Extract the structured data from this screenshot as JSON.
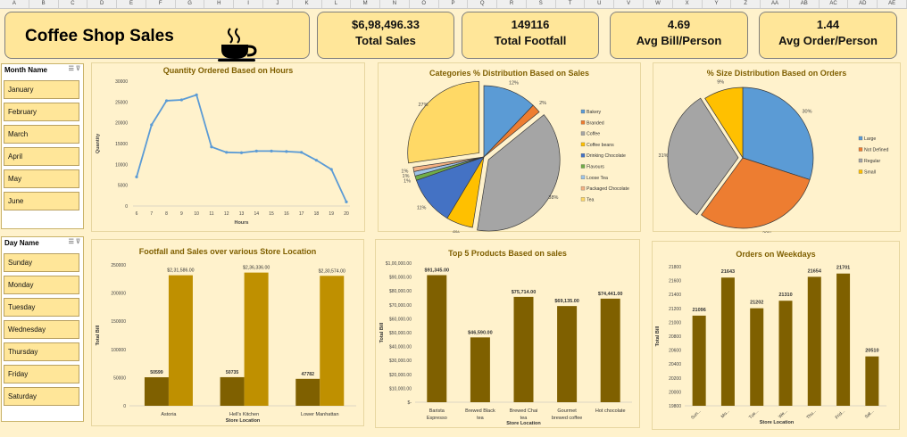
{
  "column_headers": [
    "A",
    "B",
    "C",
    "D",
    "E",
    "F",
    "G",
    "H",
    "I",
    "J",
    "K",
    "L",
    "M",
    "N",
    "O",
    "P",
    "Q",
    "R",
    "S",
    "T",
    "U",
    "V",
    "W",
    "X",
    "Y",
    "Z",
    "AA",
    "AB",
    "AC",
    "AD",
    "AE"
  ],
  "title": "Coffee Shop  Sales",
  "kpis": [
    {
      "value": "$6,98,496.33",
      "label": "Total Sales"
    },
    {
      "value": "149116",
      "label": "Total Footfall"
    },
    {
      "value": "4.69",
      "label": "Avg Bill/Person"
    },
    {
      "value": "1.44",
      "label": "Avg Order/Person"
    }
  ],
  "month_slicer": {
    "header": "Month Name",
    "items": [
      "January",
      "February",
      "March",
      "April",
      "May",
      "June"
    ]
  },
  "day_slicer": {
    "header": "Day Name",
    "items": [
      "Sunday",
      "Monday",
      "Tuesday",
      "Wednesday",
      "Thursday",
      "Friday",
      "Saturday"
    ]
  },
  "chart_data": [
    {
      "type": "line",
      "title": "Quantity Ordered Based on Hours",
      "xlabel": "Hours",
      "ylabel": "Quantity",
      "x": [
        6,
        7,
        8,
        9,
        10,
        11,
        12,
        13,
        14,
        15,
        16,
        17,
        18,
        19,
        20
      ],
      "values": [
        7000,
        19500,
        25300,
        25500,
        26700,
        14200,
        12900,
        12800,
        13200,
        13200,
        13100,
        12900,
        11000,
        8800,
        1000
      ],
      "ylim": [
        0,
        30000
      ],
      "yticks": [
        0,
        5000,
        10000,
        15000,
        20000,
        25000,
        30000
      ],
      "color": "#5b9bd5"
    },
    {
      "type": "pie",
      "title": "Categories % Distribution Based on Sales",
      "categories": [
        "Bakery",
        "Branded",
        "Coffee",
        "Coffee beans",
        "Drinking Chocolate",
        "Flavours",
        "Loose Tea",
        "Packaged Chocolate",
        "Tea"
      ],
      "values": [
        12,
        2,
        38,
        6,
        11,
        1,
        1,
        1,
        27
      ],
      "labels": [
        "12%",
        "2%",
        "38%",
        "6%",
        "11%",
        "1%",
        "1%",
        "1%",
        "27%"
      ],
      "colors": [
        "#5b9bd5",
        "#ed7d31",
        "#a5a5a5",
        "#ffc000",
        "#4472c4",
        "#70ad47",
        "#9dc3e6",
        "#f4b183",
        "#ffd966"
      ],
      "legend": "right"
    },
    {
      "type": "pie",
      "title": "% Size Distribution Based on Orders",
      "categories": [
        "Large",
        "Not Defined",
        "Regular",
        "Small"
      ],
      "values": [
        30,
        30,
        31,
        9
      ],
      "labels": [
        "30%",
        "30%",
        "31%",
        "9%"
      ],
      "colors": [
        "#5b9bd5",
        "#ed7d31",
        "#a5a5a5",
        "#ffc000"
      ],
      "legend": "right"
    },
    {
      "type": "bar",
      "title": "Footfall and Sales over various Store Location",
      "xlabel": "Store Location",
      "ylabel": "Total Bill",
      "categories": [
        "Astoria",
        "Hell's Kitchen",
        "Lower Manhattan"
      ],
      "series": [
        {
          "values": [
            50599,
            50735,
            47782
          ],
          "labels": [
            "50599",
            "50735",
            "47782"
          ],
          "color": "#7f6000"
        },
        {
          "values": [
            231586,
            236336,
            230574
          ],
          "labels": [
            "$2,31,586.00",
            "$2,36,336.00",
            "$2,30,574.00"
          ],
          "color": "#bf9000"
        }
      ],
      "ylim": [
        0,
        250000
      ],
      "yticks": [
        0,
        50000,
        100000,
        150000,
        200000,
        250000
      ]
    },
    {
      "type": "bar",
      "title": "Top  5 Products Based on sales",
      "xlabel": "Store Location",
      "ylabel": "Total Bill",
      "categories": [
        [
          "Barista",
          "Espresso"
        ],
        [
          "Brewed Black",
          "tea"
        ],
        [
          "Brewed Chai",
          "tea"
        ],
        [
          "Gourmet",
          "brewed coffee"
        ],
        [
          "Hot chocolate"
        ]
      ],
      "values": [
        91345,
        46590,
        75714,
        69135,
        74441
      ],
      "labels": [
        "$91,345.00",
        "$46,590.00",
        "$75,714.00",
        "$69,135.00",
        "$74,441.00"
      ],
      "ylim": [
        0,
        100000
      ],
      "yticks": [
        "$-",
        "$10,000.00",
        "$20,000.00",
        "$30,000.00",
        "$40,000.00",
        "$50,000.00",
        "$60,000.00",
        "$70,000.00",
        "$80,000.00",
        "$90,000.00",
        "$1,00,000.00"
      ],
      "color": "#7f6000"
    },
    {
      "type": "bar",
      "title": "Orders on Weekdays",
      "xlabel": "Store Location",
      "ylabel": "Total Bill",
      "categories": [
        "Sun...",
        "Mo...",
        "Tue...",
        "We...",
        "Thu...",
        "Frid...",
        "Sat..."
      ],
      "values": [
        21096,
        21643,
        21202,
        21310,
        21654,
        21701,
        20510
      ],
      "labels": [
        "21096",
        "21643",
        "21202",
        "21310",
        "21654",
        "21701",
        "20510"
      ],
      "ylim": [
        19800,
        21800
      ],
      "yticks": [
        19800,
        20000,
        20200,
        20400,
        20600,
        20800,
        21000,
        21200,
        21400,
        21600,
        21800
      ],
      "color": "#7f6000"
    }
  ]
}
